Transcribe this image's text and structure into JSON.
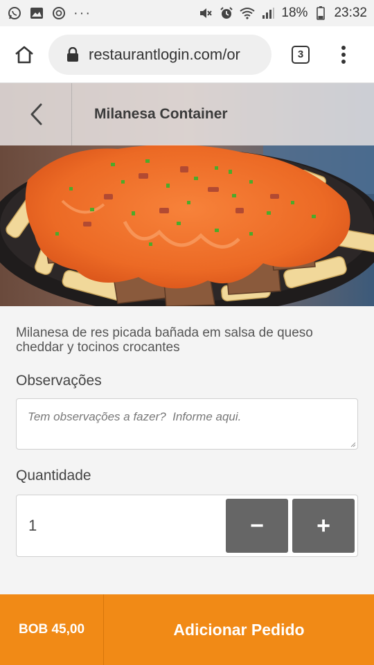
{
  "status_bar": {
    "battery": "18%",
    "time": "23:32",
    "overflow": "···"
  },
  "browser": {
    "url": "restaurantlogin.com/or",
    "tab_count": "3"
  },
  "header": {
    "title": "Milanesa Container"
  },
  "product": {
    "description": "Milanesa de res picada bañada em salsa de queso cheddar y tocinos crocantes"
  },
  "observations": {
    "label": "Observações",
    "placeholder": "Tem observações a fazer?  Informe aqui."
  },
  "quantity": {
    "label": "Quantidade",
    "value": "1",
    "decrement_label": "−",
    "increment_label": "+"
  },
  "footer": {
    "price": "BOB 45,00",
    "add_button_label": "Adicionar Pedido"
  },
  "colors": {
    "accent": "#f18a16",
    "stepper": "#666666"
  },
  "icons": {
    "back": "chevron-left-icon",
    "home": "home-icon",
    "lock": "lock-icon",
    "menu": "more-vertical-icon"
  }
}
